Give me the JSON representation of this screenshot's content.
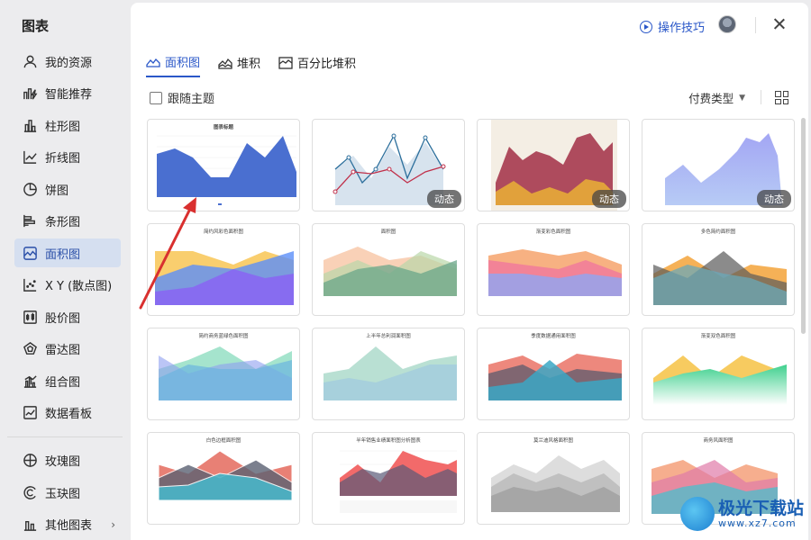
{
  "sidebar": {
    "title": "图表",
    "items": [
      {
        "label": "我的资源",
        "icon": "person-icon"
      },
      {
        "label": "智能推荐",
        "icon": "smart-recommend-icon"
      },
      {
        "label": "柱形图",
        "icon": "column-chart-icon"
      },
      {
        "label": "折线图",
        "icon": "line-chart-icon"
      },
      {
        "label": "饼图",
        "icon": "pie-chart-icon"
      },
      {
        "label": "条形图",
        "icon": "bar-chart-icon"
      },
      {
        "label": "面积图",
        "icon": "area-chart-icon",
        "active": true
      },
      {
        "label": "X Y (散点图)",
        "icon": "scatter-chart-icon"
      },
      {
        "label": "股价图",
        "icon": "stock-chart-icon"
      },
      {
        "label": "雷达图",
        "icon": "radar-chart-icon"
      },
      {
        "label": "组合图",
        "icon": "combo-chart-icon"
      },
      {
        "label": "数据看板",
        "icon": "dashboard-icon"
      }
    ],
    "extra_items": [
      {
        "label": "玫瑰图",
        "icon": "rose-chart-icon"
      },
      {
        "label": "玉玦图",
        "icon": "jade-chart-icon"
      },
      {
        "label": "其他图表",
        "icon": "other-chart-icon"
      }
    ]
  },
  "header": {
    "tips_label": "操作技巧"
  },
  "tabs": [
    {
      "label": "面积图",
      "active": true
    },
    {
      "label": "堆积"
    },
    {
      "label": "百分比堆积"
    }
  ],
  "toolbar": {
    "follow_theme_label": "跟随主题",
    "paid_type_label": "付费类型"
  },
  "cards": [
    {
      "title": "图表标题",
      "badge": ""
    },
    {
      "title": "",
      "badge": "动态"
    },
    {
      "title": "",
      "badge": "动态"
    },
    {
      "title": "",
      "badge": "动态"
    },
    {
      "title": "简约风彩色面积图",
      "badge": ""
    },
    {
      "title": "面积图",
      "badge": ""
    },
    {
      "title": "渐变彩色面积图",
      "badge": ""
    },
    {
      "title": "多色简约面积图",
      "badge": ""
    },
    {
      "title": "简约商务蓝绿色面积图",
      "badge": ""
    },
    {
      "title": "上半年总利润面积图",
      "badge": ""
    },
    {
      "title": "季度数据通用面积图",
      "badge": ""
    },
    {
      "title": "渐变双色面积图",
      "badge": ""
    },
    {
      "title": "白色边框面积图",
      "badge": ""
    },
    {
      "title": "半年销售业绩面积图分析图表",
      "badge": ""
    },
    {
      "title": "莫兰迪风格面积图",
      "badge": ""
    },
    {
      "title": "商务风面积图",
      "badge": ""
    }
  ],
  "watermark": {
    "name": "极光下载站",
    "url": "www.xz7.com"
  },
  "colors": {
    "accent": "#2a57c8",
    "active_bg": "#d5dff0"
  }
}
